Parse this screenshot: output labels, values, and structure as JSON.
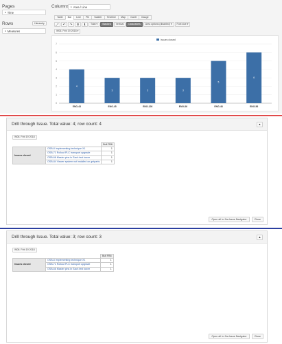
{
  "left": {
    "pages_title": "Pages",
    "pages_chip": "Time",
    "rows_title": "Rows",
    "rows_button": "Hierarchy",
    "rows_chip": "Measures"
  },
  "columns": {
    "title": "Columns",
    "chip": "Area / Line"
  },
  "view_tabs": [
    "Table",
    "Bar",
    "Line",
    "Pie",
    "Scatter",
    "Timeline",
    "Map",
    "Gantt",
    "Gauge"
  ],
  "active_view_tab": "Bar",
  "toolbar": {
    "icons": [
      "expand-icon",
      "undo-icon",
      "redo-icon",
      "settings-icon",
      "download-icon"
    ],
    "icon_glyphs": [
      "⤢",
      "↶",
      "↷",
      "⚙",
      "⬇"
    ],
    "total_label": "Total ▾",
    "stacked_label": "Stacked",
    "vertical_label": "Vertical",
    "data_labels_label": "Data labels",
    "area_options_label": "Area options (disabled) ▾",
    "font_size_label": "Font size ▾"
  },
  "date_filter": "W06. Feb 19 2018 ▾",
  "chart_data": {
    "type": "bar",
    "legend": "Issues closed",
    "legend_color": "#3c6fa7",
    "categories": [
      "ENG-43",
      "ENG-45",
      "ENG-126",
      "ENG-86",
      "ENG-48",
      "ENG-56"
    ],
    "values": [
      4,
      3,
      3,
      3,
      5,
      6
    ],
    "ylim": [
      0,
      7
    ],
    "yticks": [
      0,
      1,
      2,
      3,
      4,
      5,
      6,
      7
    ],
    "bar_color": "#3c6fa7"
  },
  "dialog1": {
    "title": "Drill through Issue. Total value: 4; row count: 4",
    "date": "W06. Feb 19 2018",
    "col_header": "Bull FB6",
    "row_header": "Issues closed",
    "rows": [
      {
        "issue": "OSB-8 Implementing technique X1",
        "value": "1"
      },
      {
        "issue": "OSB-71 Rollout PLC transport upgrade",
        "value": "1"
      },
      {
        "issue": "OSB-66 Master pins in Each test tower",
        "value": "1"
      },
      {
        "issue": "OSB-84 Viewer system not installed on getparts",
        "value": "1"
      }
    ],
    "open_btn": "Open all in Jira Issue Navigator",
    "close_btn": "Close"
  },
  "dialog2": {
    "title": "Drill through Issue. Total value: 3; row count: 3",
    "date": "W06. Feb 19 2018",
    "col_header": "Bull FB6",
    "row_header": "Issues closed",
    "rows": [
      {
        "issue": "OSB-8 Implementing technique X1",
        "value": "1"
      },
      {
        "issue": "OSB-71 Rollout PLC transport upgrade",
        "value": "1"
      },
      {
        "issue": "OSB-66 Master pins in Each test tower",
        "value": "1"
      }
    ],
    "open_btn": "Open all in Jira Issue Navigator",
    "close_btn": "Close"
  }
}
